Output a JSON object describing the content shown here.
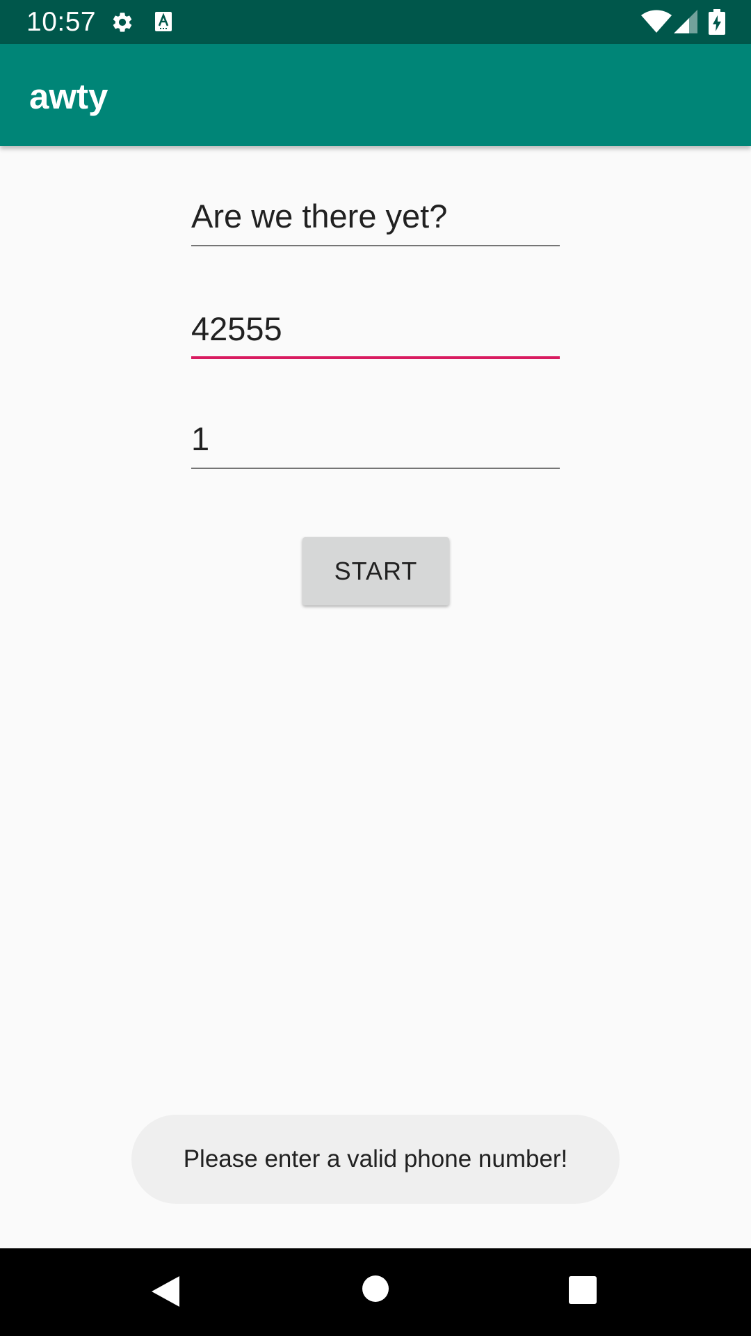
{
  "status_bar": {
    "time": "10:57",
    "icons": [
      "gear-icon",
      "keyboard-a-icon",
      "wifi-icon",
      "cell-signal-icon",
      "battery-charging-icon"
    ]
  },
  "app_bar": {
    "title": "awty"
  },
  "form": {
    "message_value": "Are we there yet?",
    "phone_value": "42555",
    "interval_value": "1",
    "start_label": "START"
  },
  "toast": {
    "text": "Please enter a valid phone number!"
  },
  "nav_bar": {
    "icons": [
      "back-icon",
      "home-icon",
      "recents-icon"
    ]
  },
  "colors": {
    "status_bar": "#00574b",
    "app_bar": "#008577",
    "accent": "#d81b60",
    "background": "#fafafa"
  }
}
